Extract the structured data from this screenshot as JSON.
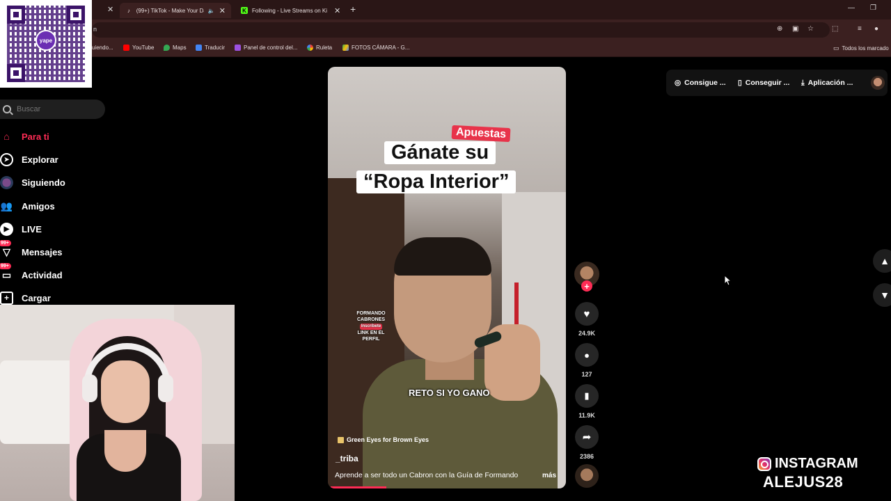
{
  "browser": {
    "tabs": [
      {
        "title": "(99+) TikTok - Make Your Da",
        "active": true
      },
      {
        "title": "Following - Live Streams on Ki",
        "active": false
      }
    ],
    "new_tab": "+",
    "window_controls": {
      "minimize": "—",
      "restore": "❐"
    },
    "address_fragment": "n",
    "bookmarks": [
      {
        "label": "uiendo...",
        "color": "#777777"
      },
      {
        "label": "YouTube",
        "color": "#ff0000"
      },
      {
        "label": "Maps",
        "color": "#34a853"
      },
      {
        "label": "Traducir",
        "color": "#4285f4"
      },
      {
        "label": "Panel de control del...",
        "color": "#9b51e0"
      },
      {
        "label": "Ruleta",
        "color": "#f4b400"
      },
      {
        "label": "FOTOS CÁMARA - G...",
        "color": "#fbbc05"
      }
    ],
    "all_bookmarks": "Todos los marcado"
  },
  "qr": {
    "logo_text": "yape"
  },
  "sidebar": {
    "search_placeholder": "Buscar",
    "items": [
      {
        "label": "Para ti",
        "icon": "home-icon",
        "active": true
      },
      {
        "label": "Explorar",
        "icon": "compass-icon",
        "active": false
      },
      {
        "label": "Siguiendo",
        "icon": "following-avatar-icon",
        "active": false
      },
      {
        "label": "Amigos",
        "icon": "friends-icon",
        "active": false
      },
      {
        "label": "LIVE",
        "icon": "live-icon",
        "active": false
      },
      {
        "label": "Mensajes",
        "icon": "messages-icon",
        "active": false,
        "badge": "99+"
      },
      {
        "label": "Actividad",
        "icon": "activity-icon",
        "active": false,
        "badge": "99+"
      },
      {
        "label": "Cargar",
        "icon": "upload-icon",
        "active": false
      }
    ]
  },
  "video": {
    "tag": "Apuestas",
    "caption_line1": "Gánate su",
    "caption_line2": "“Ropa Interior”",
    "subtitle": "RETO SI YO GANO",
    "overlay_lines": [
      "FORMANDO",
      "CABRONES",
      "Inscríbete",
      "LINK EN EL PERFIL"
    ],
    "music": "Green Eyes for Brown Eyes",
    "author": "_triba",
    "description": "Aprende a ser todo un Cabron con la Guía de Formando",
    "more": "más",
    "progress": 0.24
  },
  "actions": {
    "likes": "24.9K",
    "comments": "127",
    "saves": "11.9K",
    "shares": "2386"
  },
  "top_right": {
    "coins": "Consigue ...",
    "get_app": "Conseguir ...",
    "download": "Aplicación ..."
  },
  "overlay": {
    "instagram_label": "INSTAGRAM",
    "handle": "ALEJUS28"
  }
}
